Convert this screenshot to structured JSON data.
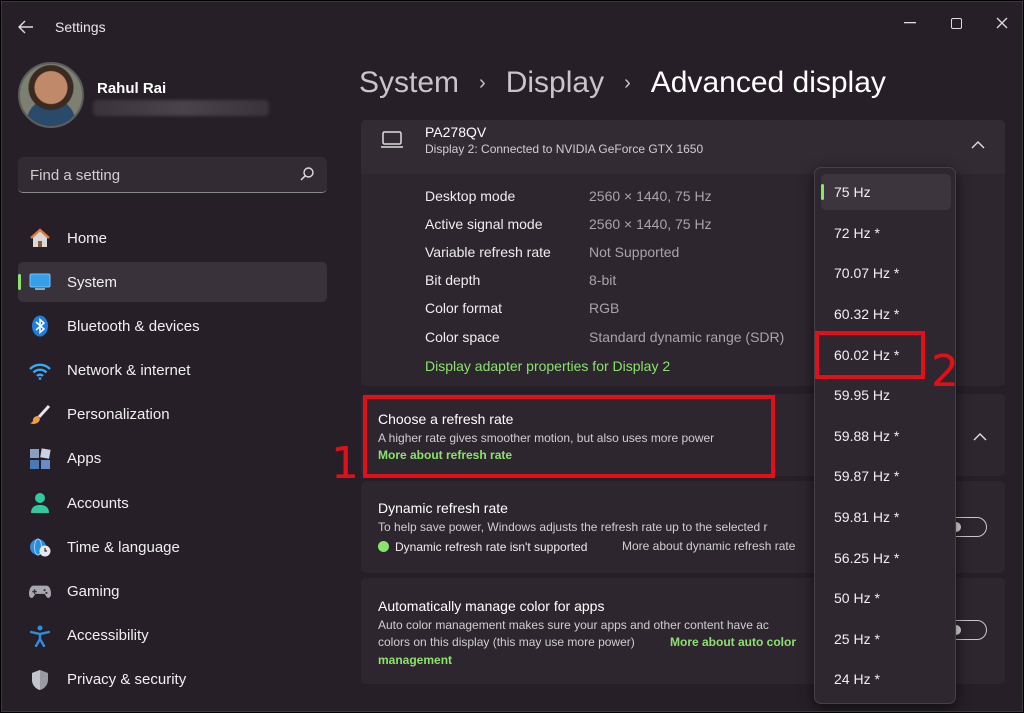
{
  "window": {
    "title": "Settings"
  },
  "profile": {
    "name": "Rahul Rai"
  },
  "search": {
    "placeholder": "Find a setting"
  },
  "sidebar": {
    "items": [
      {
        "label": "Home",
        "icon": "home-icon"
      },
      {
        "label": "System",
        "icon": "system-icon",
        "active": true
      },
      {
        "label": "Bluetooth & devices",
        "icon": "bluetooth-icon"
      },
      {
        "label": "Network & internet",
        "icon": "wifi-icon"
      },
      {
        "label": "Personalization",
        "icon": "brush-icon"
      },
      {
        "label": "Apps",
        "icon": "apps-icon"
      },
      {
        "label": "Accounts",
        "icon": "person-icon"
      },
      {
        "label": "Time & language",
        "icon": "clock-globe-icon"
      },
      {
        "label": "Gaming",
        "icon": "gamepad-icon"
      },
      {
        "label": "Accessibility",
        "icon": "accessibility-icon"
      },
      {
        "label": "Privacy & security",
        "icon": "shield-icon"
      }
    ]
  },
  "breadcrumb": {
    "level1": "System",
    "level2": "Display",
    "current": "Advanced display"
  },
  "monitor": {
    "name": "PA278QV",
    "description": "Display 2: Connected to NVIDIA GeForce GTX 1650",
    "details": [
      {
        "label": "Desktop mode",
        "value": "2560 × 1440, 75 Hz"
      },
      {
        "label": "Active signal mode",
        "value": "2560 × 1440, 75 Hz"
      },
      {
        "label": "Variable refresh rate",
        "value": "Not Supported"
      },
      {
        "label": "Bit depth",
        "value": "8-bit"
      },
      {
        "label": "Color format",
        "value": "RGB"
      },
      {
        "label": "Color space",
        "value": "Standard dynamic range (SDR)"
      }
    ],
    "adapter_link": "Display adapter properties for Display 2"
  },
  "refresh": {
    "title": "Choose a refresh rate",
    "description": "A higher rate gives smoother motion, but also uses more power",
    "link": "More about refresh rate"
  },
  "dynamic": {
    "title": "Dynamic refresh rate",
    "description": "To help save power, Windows adjusts the refresh rate up to the selected r",
    "status": "Dynamic refresh rate isn't supported",
    "link": "More about dynamic refresh rate"
  },
  "color": {
    "title": "Automatically manage color for apps",
    "description_line1": "Auto color management makes sure your apps and other content have ac",
    "description_line2": "colors on this display (this may use more power)",
    "link_part1": "More about auto color",
    "link_part2": "management"
  },
  "dropdown": {
    "options": [
      "75 Hz",
      "72 Hz *",
      "70.07 Hz *",
      "60.32 Hz *",
      "60.02 Hz *",
      "59.95 Hz",
      "59.88 Hz *",
      "59.87 Hz *",
      "59.81 Hz *",
      "56.25 Hz *",
      "50 Hz *",
      "25 Hz *",
      "24 Hz *"
    ],
    "selected": "75 Hz"
  },
  "annotations": {
    "step1": "1",
    "step2": "2",
    "color": "#e0101a"
  },
  "colors": {
    "accent": "#8ce26f",
    "background": "#271f27",
    "card": "#2e262e"
  }
}
